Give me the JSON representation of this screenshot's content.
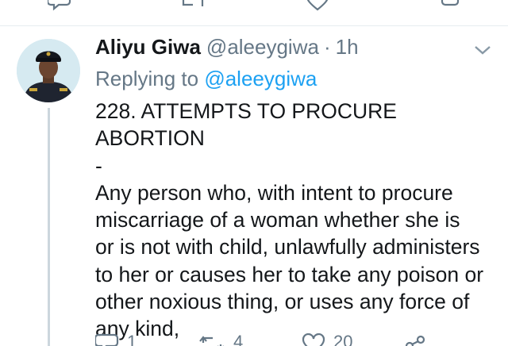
{
  "tweet": {
    "author": {
      "display_name": "Aliyu Giwa",
      "handle": "@aleeygiwa",
      "separator": "·",
      "time": "1h"
    },
    "replying": {
      "prefix": "Replying to",
      "handle": "@aleeygiwa"
    },
    "text": "228. ATTEMPTS TO PROCURE ABORTION\n-\nAny person who, with intent to procure\nmiscarriage of a woman whether she is\nor is not with child, unlawfully administers\nto her or causes her to take any poison or\nother noxious thing, or uses any force of\nany kind,",
    "actions": {
      "reply_count": "1",
      "retweet_count": "4",
      "like_count": "20"
    }
  },
  "icons": {
    "avatar": "police-officer-avatar",
    "menu": "chevron-down-icon",
    "reply": "reply-icon",
    "retweet": "retweet-icon",
    "like": "heart-icon",
    "share": "share-icon"
  },
  "colors": {
    "link": "#1da1f2",
    "secondary_text": "#657786",
    "primary_text": "#14171a",
    "thread_line": "#ccd6dd"
  }
}
